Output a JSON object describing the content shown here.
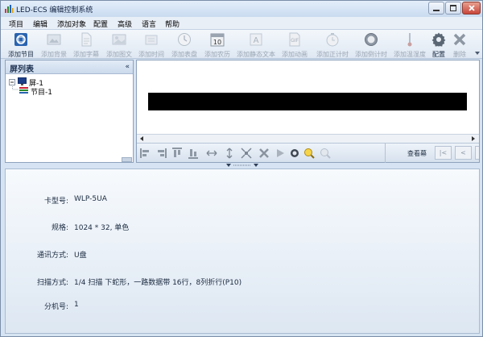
{
  "window": {
    "title": "LED-ECS 编辑控制系统"
  },
  "menu": [
    "项目",
    "编辑",
    "添加对象",
    "配置",
    "高级",
    "语言",
    "帮助"
  ],
  "toolbar": [
    {
      "label": "添加节目",
      "icon": "program-icon",
      "enabled": true
    },
    {
      "label": "添加背景",
      "icon": "background-icon",
      "enabled": false
    },
    {
      "label": "添加字幕",
      "icon": "subtitle-icon",
      "enabled": false
    },
    {
      "label": "添加图文",
      "icon": "image-text-icon",
      "enabled": false
    },
    {
      "label": "添加时间",
      "icon": "time-icon",
      "enabled": false
    },
    {
      "label": "添加表盘",
      "icon": "clock-dial-icon",
      "enabled": false
    },
    {
      "label": "添加农历",
      "icon": "calendar-icon",
      "enabled": false
    },
    {
      "label": "添加静态文本",
      "icon": "static-text-icon",
      "enabled": false
    },
    {
      "label": "添加动画",
      "icon": "gif-icon",
      "enabled": false
    },
    {
      "label": "添加正计时",
      "icon": "count-up-icon",
      "enabled": false
    },
    {
      "label": "添加倒计时",
      "icon": "countdown-icon",
      "enabled": false
    },
    {
      "label": "添加温湿度",
      "icon": "thermometer-icon",
      "enabled": false
    },
    {
      "label": "配置",
      "icon": "gear-icon",
      "enabled": true
    },
    {
      "label": "删除",
      "icon": "delete-icon",
      "enabled": false
    }
  ],
  "screen_panel": {
    "title": "屏列表",
    "collapse": "«",
    "screen": "屏-1",
    "program": "节目-1"
  },
  "preview": {
    "view_label": "查看幕",
    "first": "|<",
    "prev": "<"
  },
  "info": [
    {
      "key": "卡型号:",
      "value": "WLP-5UA"
    },
    {
      "key": "规格:",
      "value": "1024 * 32, 单色"
    },
    {
      "key": "通讯方式:",
      "value": "U盘"
    },
    {
      "key": "扫描方式:",
      "value": "1/4 扫描 下蛇形，一路数据带 16行，8列折行(P10)"
    },
    {
      "key": "分机号:",
      "value": "1"
    }
  ],
  "colors": {
    "accent": "#2a64b0",
    "screen": "#000000",
    "panel_bg": "#d6e3f2"
  }
}
